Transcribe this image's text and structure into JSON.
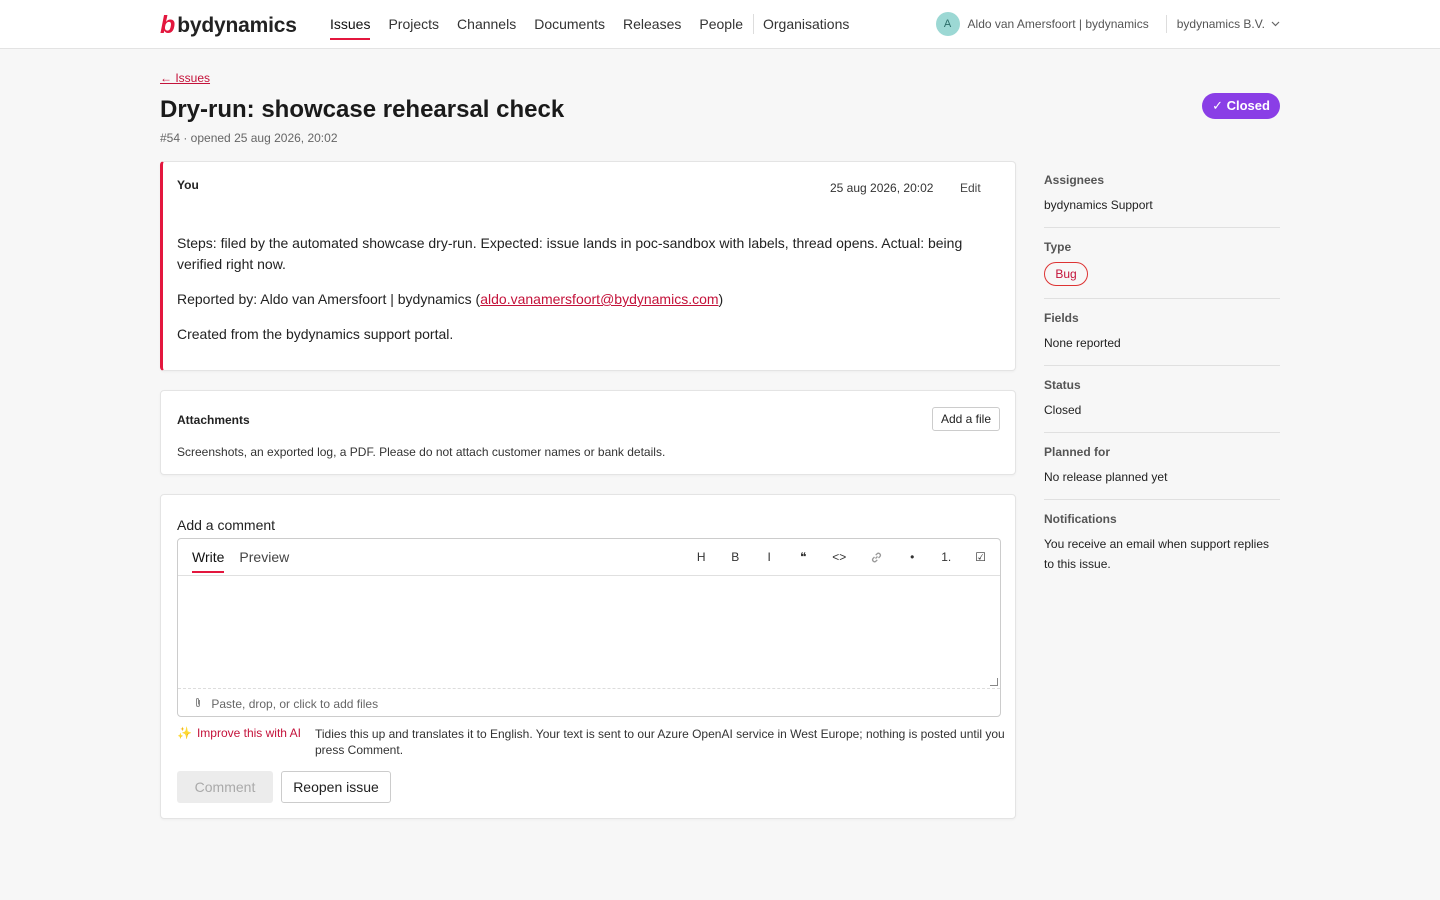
{
  "brand": {
    "mark": "b",
    "name": "bydynamics"
  },
  "nav": {
    "items": [
      "Issues",
      "Projects",
      "Channels",
      "Documents",
      "Releases",
      "People"
    ],
    "extra": "Organisations"
  },
  "user": {
    "avatar": "A",
    "name": "Aldo van Amersfoort | bydynamics",
    "org": "bydynamics B.V.",
    "org_icon": "chevron-down-icon"
  },
  "header": {
    "back": "← Issues",
    "title": "Dry-run: showcase rehearsal check",
    "meta": "#54 · opened 25 aug 2026, 20:02",
    "status_badge": "✓ Closed"
  },
  "description": {
    "author": "You",
    "date": "25 aug 2026, 20:02",
    "edit": "Edit",
    "p1": "Steps: filed by the automated showcase dry-run. Expected: issue lands in poc-sandbox with labels, thread opens. Actual: being verified right now.",
    "p2_prefix": "Reported by: Aldo van Amersfoort | bydynamics (",
    "p2_email": "aldo.vanamersfoort@bydynamics.com",
    "p2_suffix": ")",
    "p3": "Created from the bydynamics support portal."
  },
  "attachments": {
    "heading": "Attachments",
    "add_button": "Add a file",
    "note": "Screenshots, an exported log, a PDF. Please do not attach customer names or bank details."
  },
  "comment": {
    "heading": "Add a comment",
    "tab_write": "Write",
    "tab_preview": "Preview",
    "tools": [
      "H",
      "B",
      "I",
      "❝",
      "<>",
      "🔗",
      "•",
      "1.",
      "☑"
    ],
    "dropzone": "Paste, drop, or click to add files",
    "ai_link": "Improve this with AI",
    "ai_note": "Tidies this up and translates it to English. Your text is sent to our Azure OpenAI service in West Europe; nothing is posted until you press Comment.",
    "comment_button": "Comment",
    "reopen_button": "Reopen issue"
  },
  "sidebar": {
    "assignees_label": "Assignees",
    "assignees_value": "bydynamics Support",
    "type_label": "Type",
    "type_value": "Bug",
    "fields_label": "Fields",
    "fields_value": "None reported",
    "status_label": "Status",
    "status_value": "Closed",
    "planned_label": "Planned for",
    "planned_value": "No release planned yet",
    "notifications_label": "Notifications",
    "notifications_value": "You receive an email when support replies to this issue."
  },
  "colors": {
    "accent": "#e3173e",
    "closed": "#8a3ee6"
  }
}
